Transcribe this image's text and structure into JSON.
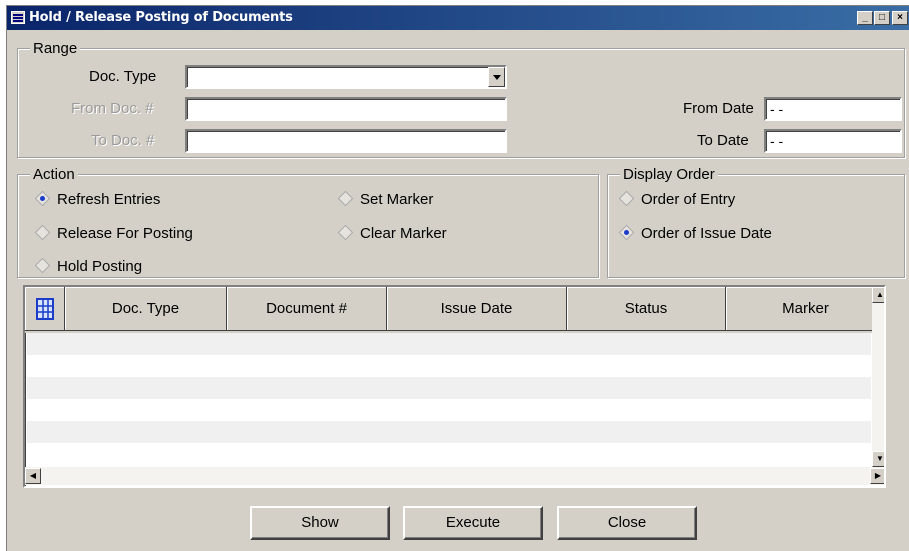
{
  "window": {
    "title": "Hold / Release Posting of Documents"
  },
  "range": {
    "legend": "Range",
    "doc_type_label": "Doc. Type",
    "doc_type_value": "",
    "from_doc_label": "From Doc. #",
    "from_doc_value": "",
    "to_doc_label": "To Doc. #",
    "to_doc_value": "",
    "from_date_label": "From Date",
    "from_date_value": "- -",
    "to_date_label": "To Date",
    "to_date_value": "- -"
  },
  "action": {
    "legend": "Action",
    "options": [
      {
        "label": "Refresh Entries",
        "selected": true
      },
      {
        "label": "Release For Posting",
        "selected": false
      },
      {
        "label": "Hold Posting",
        "selected": false
      },
      {
        "label": "Set Marker",
        "selected": false
      },
      {
        "label": "Clear Marker",
        "selected": false
      }
    ]
  },
  "display_order": {
    "legend": "Display Order",
    "options": [
      {
        "label": "Order of Entry",
        "selected": false
      },
      {
        "label": "Order of Issue Date",
        "selected": true
      }
    ]
  },
  "grid": {
    "columns": [
      "Doc. Type",
      "Document #",
      "Issue Date",
      "Status",
      "Marker"
    ],
    "rows": []
  },
  "buttons": {
    "show": "Show",
    "execute": "Execute",
    "close": "Close"
  },
  "icons": {
    "window": "window-menu-icon",
    "grid_corner": "grid-select-all-icon"
  }
}
